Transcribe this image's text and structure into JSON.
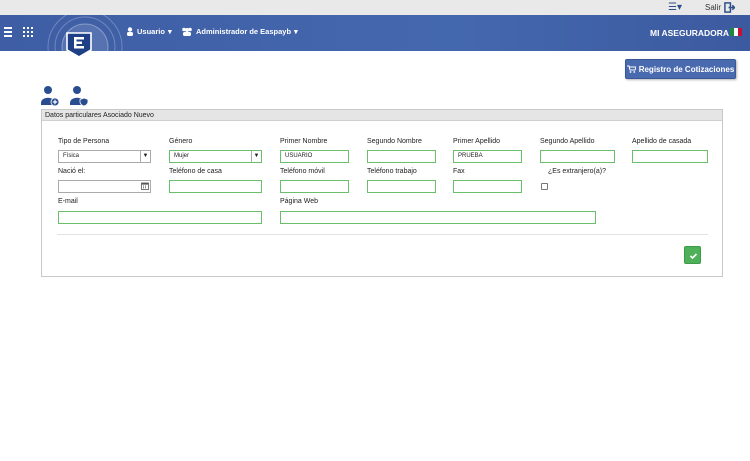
{
  "topbar": {
    "help_icon": "help-icon",
    "salir": "Salir",
    "exit_icon": "exit-icon"
  },
  "navbar": {
    "menu_usuario": "Usuario",
    "menu_admin": "Administrador de Easpayb",
    "brand": "MI ASEGURADORA",
    "flag": "mexico-flag-icon"
  },
  "toolbar": {
    "registro_button": "Registro de Cotizaciones"
  },
  "panel": {
    "title": "Datos particulares Asociado Nuevo"
  },
  "form": {
    "tipo_persona": {
      "label": "Tipo de Persona",
      "value": "Física"
    },
    "genero": {
      "label": "Género",
      "value": "Mujer"
    },
    "primer_nombre": {
      "label": "Primer Nombre",
      "value": "USUARIO"
    },
    "segundo_nombre": {
      "label": "Segundo Nombre",
      "value": ""
    },
    "primer_apellido": {
      "label": "Primer Apellido",
      "value": "PRUEBA"
    },
    "segundo_apellido": {
      "label": "Segundo Apellido",
      "value": ""
    },
    "apellido_casada": {
      "label": "Apellido de casada",
      "value": ""
    },
    "nacio_el": {
      "label": "Nació el:",
      "value": ""
    },
    "telefono_casa": {
      "label": "Teléfono de casa",
      "value": ""
    },
    "telefono_movil": {
      "label": "Teléfono móvil",
      "value": ""
    },
    "telefono_trabajo": {
      "label": "Teléfono trabajo",
      "value": ""
    },
    "fax": {
      "label": "Fax",
      "value": ""
    },
    "extranjero": {
      "label": "¿Es extranjero(a)?",
      "checked": false
    },
    "email": {
      "label": "E-mail",
      "value": ""
    },
    "pagina_web": {
      "label": "Página Web",
      "value": ""
    }
  },
  "colors": {
    "navbar": "#4468ae",
    "field_border": "#6bbf6b",
    "ok_button": "#4fb05a"
  }
}
